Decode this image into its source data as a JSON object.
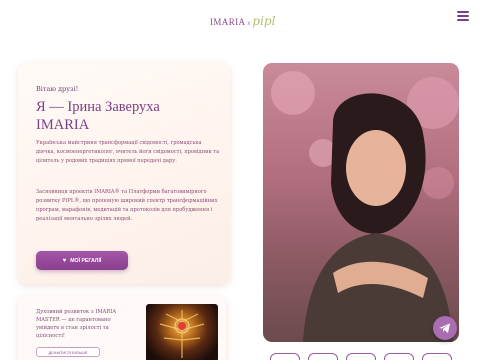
{
  "header": {
    "logo": {
      "main": "IMARIA",
      "separator": "x",
      "secondary": "pipl"
    },
    "menu_icon": "hamburger-menu-icon"
  },
  "hero": {
    "greeting": "Вітаю друзі!",
    "title_line1": "Я — Ірина Заверуха",
    "title_line2": "IMARIA",
    "paragraph1": "Українська майстриня трансформації свідомості, громадська діячка, космоенергетиколог, вчитель йоги свідомості, провідник та цілитель у родових традиціях прямої передачі дару.",
    "paragraph2": "Засновниця проектів IMARIA® та Платформи багатовимірного розвитку PIPL®, що пропоную широкий спектр трансформаційних програм, марафонів, медитацій та протоколів для пробудження і реалізації ментально зрілих людей.",
    "cta_label": "МОЇ РЕГАЛІЇ",
    "cta_icon": "heart-icon"
  },
  "promo_card": {
    "text": "Духовний розвиток з IMARIA MASTER — це гарантовано увійдете в стан зрілості та цілісності!",
    "button_label": "ДІЗНАТИСЯ БІЛЬШЕ"
  },
  "floating_button": {
    "icon": "telegram-icon"
  },
  "socials": [
    "telegram-icon",
    "youtube-icon",
    "instagram-icon",
    "facebook-icon",
    "tiktok-icon"
  ],
  "colors": {
    "accent": "#8a3f8e",
    "text_purple": "#7b3f86",
    "card_bg": "#fff4ee",
    "logo_green": "#b5c06a"
  }
}
